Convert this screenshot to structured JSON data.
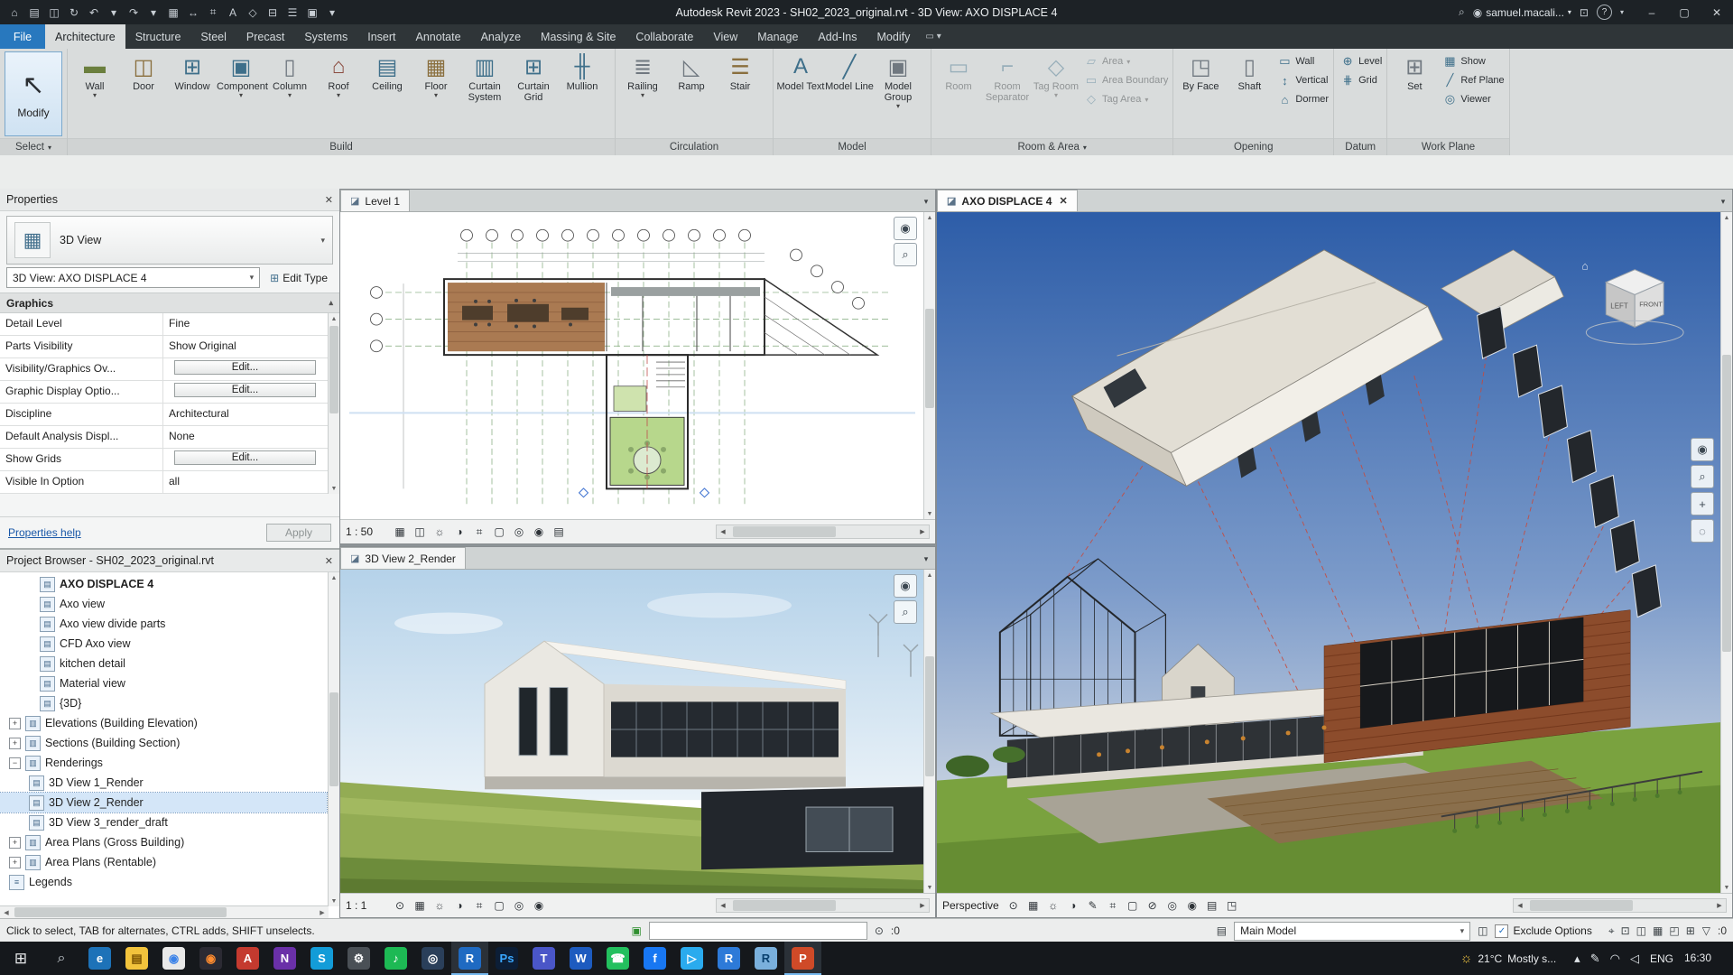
{
  "icons": {
    "caret_down": "▾",
    "caret_up": "▴",
    "close": "✕",
    "minimize": "–",
    "maximize": "▢",
    "left_arrow": "◀",
    "right_arrow": "▶",
    "up_arrow": "▲",
    "down_arrow": "▼",
    "check": "✓",
    "help": "?",
    "search": "⌕",
    "panel_toggle": "▭",
    "home": "⌂"
  },
  "title_bar": {
    "title": "Autodesk Revit 2023 - SH02_2023_original.rvt - 3D View: AXO DISPLACE 4",
    "user": "samuel.macali...",
    "qat_icons": [
      {
        "n": "home-icon",
        "g": "⌂"
      },
      {
        "n": "open-icon",
        "g": "▤"
      },
      {
        "n": "save-icon",
        "g": "◫"
      },
      {
        "n": "sync-icon",
        "g": "↻"
      },
      {
        "n": "undo-icon",
        "g": "↶"
      },
      {
        "n": "undo-dropdown-icon",
        "g": "▾"
      },
      {
        "n": "redo-icon",
        "g": "↷"
      },
      {
        "n": "redo-dropdown-icon",
        "g": "▾"
      },
      {
        "n": "print-icon",
        "g": "▦"
      },
      {
        "n": "measure-icon",
        "g": "↔"
      },
      {
        "n": "aligned-dimension-icon",
        "g": "⌗"
      },
      {
        "n": "text-icon",
        "g": "A"
      },
      {
        "n": "default-3d-view-icon",
        "g": "◇"
      },
      {
        "n": "section-icon",
        "g": "⊟"
      },
      {
        "n": "thin-lines-icon",
        "g": "☰"
      },
      {
        "n": "switch-windows-icon",
        "g": "▣"
      },
      {
        "n": "qat-customize-icon",
        "g": "▾"
      }
    ],
    "right_icons_a": [
      {
        "n": "search-icon",
        "g": "⌕"
      },
      {
        "n": "account-icon",
        "g": "◉"
      }
    ],
    "right_icons_b": [
      {
        "n": "app-store-icon",
        "g": "⊡"
      }
    ],
    "window_controls": [
      {
        "n": "minimize-button",
        "g": "–"
      },
      {
        "n": "maximize-button",
        "g": "▢"
      },
      {
        "n": "close-button",
        "g": "✕"
      }
    ]
  },
  "ribbon": {
    "file_tab": "File",
    "select_label": "Select",
    "modify_button": {
      "label": "Modify",
      "icon": "↖"
    },
    "tabs": [
      {
        "n": "tab-architecture",
        "label": "Architecture",
        "active": true
      },
      {
        "n": "tab-structure",
        "label": "Structure"
      },
      {
        "n": "tab-steel",
        "label": "Steel"
      },
      {
        "n": "tab-precast",
        "label": "Precast"
      },
      {
        "n": "tab-systems",
        "label": "Systems"
      },
      {
        "n": "tab-insert",
        "label": "Insert"
      },
      {
        "n": "tab-annotate",
        "label": "Annotate"
      },
      {
        "n": "tab-analyze",
        "label": "Analyze"
      },
      {
        "n": "tab-massing-site",
        "label": "Massing & Site"
      },
      {
        "n": "tab-collaborate",
        "label": "Collaborate"
      },
      {
        "n": "tab-view",
        "label": "View"
      },
      {
        "n": "tab-manage",
        "label": "Manage"
      },
      {
        "n": "tab-addins",
        "label": "Add-Ins"
      },
      {
        "n": "tab-modify",
        "label": "Modify"
      }
    ],
    "panels": [
      {
        "pn": "ribbon-panel-build",
        "label": "Build",
        "big": [
          {
            "n": "wall-button",
            "label": "Wall",
            "icon": "▬",
            "arrow": true,
            "c": "#6b7f3e"
          },
          {
            "n": "door-button",
            "label": "Door",
            "icon": "◫",
            "c": "#8a6f3e"
          },
          {
            "n": "window-button",
            "label": "Window",
            "icon": "⊞",
            "c": "#3e6f8a"
          },
          {
            "n": "component-button",
            "label": "Component",
            "icon": "▣",
            "arrow": true,
            "c": "#3e6f8a"
          },
          {
            "n": "column-button",
            "label": "Column",
            "icon": "▯",
            "arrow": true,
            "c": "#707880"
          },
          {
            "n": "roof-button",
            "label": "Roof",
            "icon": "⌂",
            "arrow": true,
            "c": "#8a4a3e"
          },
          {
            "n": "ceiling-button",
            "label": "Ceiling",
            "icon": "▤",
            "c": "#3e6f8a"
          },
          {
            "n": "floor-button",
            "label": "Floor",
            "icon": "▦",
            "arrow": true,
            "c": "#8a6f3e"
          },
          {
            "n": "curtain-system-button",
            "label": "Curtain System",
            "icon": "▥",
            "c": "#3e6f8a"
          },
          {
            "n": "curtain-grid-button",
            "label": "Curtain Grid",
            "icon": "⊞",
            "c": "#3e6f8a"
          },
          {
            "n": "mullion-button",
            "label": "Mullion",
            "icon": "╫",
            "c": "#3e6f8a"
          }
        ],
        "small": []
      },
      {
        "pn": "ribbon-panel-circulation",
        "label": "Circulation",
        "big": [
          {
            "n": "railing-button",
            "label": "Railing",
            "icon": "≣",
            "arrow": true,
            "c": "#707880"
          },
          {
            "n": "ramp-button",
            "label": "Ramp",
            "icon": "◺",
            "c": "#707880"
          },
          {
            "n": "stair-button",
            "label": "Stair",
            "icon": "☰",
            "c": "#8a6f3e"
          }
        ],
        "small": []
      },
      {
        "pn": "ribbon-panel-model",
        "label": "Model",
        "big": [
          {
            "n": "model-text-button",
            "label": "Model Text",
            "icon": "A",
            "c": "#3e6f8a"
          },
          {
            "n": "model-line-button",
            "label": "Model Line",
            "icon": "╱",
            "c": "#3e6f8a"
          },
          {
            "n": "model-group-button",
            "label": "Model Group",
            "icon": "▣",
            "arrow": true,
            "c": "#707880"
          }
        ],
        "small": []
      },
      {
        "pn": "ribbon-panel-room-area",
        "label": "Room & Area",
        "arrow": true,
        "big": [
          {
            "n": "room-button",
            "label": "Room",
            "icon": "▭",
            "dis": true,
            "c": "#3e6f8a"
          },
          {
            "n": "room-separator-button",
            "label": "Room Separator",
            "icon": "⌐",
            "dis": true,
            "c": "#3e6f8a"
          },
          {
            "n": "tag-room-button",
            "label": "Tag Room",
            "icon": "◇",
            "arrow": true,
            "dis": true,
            "c": "#3e6f8a"
          }
        ],
        "small": [
          {
            "n": "area-button",
            "label": "Area",
            "icon": "▱",
            "arrow": true,
            "dis": true
          },
          {
            "n": "area-boundary-button",
            "label": "Area Boundary",
            "icon": "▭",
            "dis": true
          },
          {
            "n": "tag-area-button",
            "label": "Tag Area",
            "icon": "◇",
            "arrow": true,
            "dis": true
          }
        ]
      },
      {
        "pn": "ribbon-panel-opening",
        "label": "Opening",
        "big": [
          {
            "n": "opening-by-face-button",
            "label": "By Face",
            "icon": "◳",
            "c": "#707880"
          },
          {
            "n": "shaft-button",
            "label": "Shaft",
            "icon": "▯",
            "c": "#707880"
          }
        ],
        "small": [
          {
            "n": "wall-opening-button",
            "label": "Wall",
            "icon": "▭"
          },
          {
            "n": "vertical-opening-button",
            "label": "Vertical",
            "icon": "↕"
          },
          {
            "n": "dormer-button",
            "label": "Dormer",
            "icon": "⌂"
          }
        ]
      },
      {
        "pn": "ribbon-panel-datum",
        "label": "Datum",
        "big": [],
        "small": [
          {
            "n": "level-button",
            "label": "Level",
            "icon": "⊕"
          },
          {
            "n": "grid-button",
            "label": "Grid",
            "icon": "⋕"
          }
        ]
      },
      {
        "pn": "ribbon-panel-work-plane",
        "label": "Work Plane",
        "big": [
          {
            "n": "set-work-plane-button",
            "label": "Set",
            "icon": "⊞",
            "c": "#707880"
          }
        ],
        "small": [
          {
            "n": "show-work-plane-button",
            "label": "Show",
            "icon": "▦"
          },
          {
            "n": "ref-plane-button",
            "label": "Ref Plane",
            "icon": "╱"
          },
          {
            "n": "viewer-button",
            "label": "Viewer",
            "icon": "◎"
          }
        ]
      }
    ]
  },
  "properties": {
    "title": "Properties",
    "type_icon": "▦",
    "type_label": "3D View",
    "selector_value": "3D View: AXO DISPLACE 4",
    "edit_type_icon": "⊞",
    "edit_type_label": "Edit Type",
    "section_graphics": "Graphics",
    "rows": [
      {
        "label": "Detail Level",
        "value": "Fine",
        "txt": true
      },
      {
        "label": "Parts Visibility",
        "value": "Show Original",
        "txt": true
      },
      {
        "label": "Visibility/Graphics Ov...",
        "value": "Edit...",
        "btn": true
      },
      {
        "label": "Graphic Display Optio...",
        "value": "Edit...",
        "btn": true
      },
      {
        "label": "Discipline",
        "value": "Architectural",
        "txt": true
      },
      {
        "label": "Default Analysis Displ...",
        "value": "None",
        "txt": true
      },
      {
        "label": "Show Grids",
        "value": "Edit...",
        "btn": true
      },
      {
        "label": "Visible In Option",
        "value": "all",
        "txt": true
      }
    ],
    "help_label": "Properties help",
    "apply_label": "Apply"
  },
  "browser": {
    "title": "Project Browser - SH02_2023_original.rvt",
    "items": [
      {
        "label": "AXO DISPLACE 4",
        "pad": "44px",
        "bold": true,
        "ticon": "▤"
      },
      {
        "label": "Axo view",
        "pad": "44px",
        "ticon": "▤"
      },
      {
        "label": "Axo view divide parts",
        "pad": "44px",
        "ticon": "▤"
      },
      {
        "label": "CFD Axo view",
        "pad": "44px",
        "ticon": "▤"
      },
      {
        "label": "kitchen detail",
        "pad": "44px",
        "ticon": "▤"
      },
      {
        "label": "Material view",
        "pad": "44px",
        "ticon": "▤"
      },
      {
        "label": "{3D}",
        "pad": "44px",
        "ticon": "▤"
      },
      {
        "label": "Elevations (Building Elevation)",
        "pad": "10px",
        "exp": "+",
        "ticon": "▥"
      },
      {
        "label": "Sections (Building Section)",
        "pad": "10px",
        "exp": "+",
        "ticon": "▥"
      },
      {
        "label": "Renderings",
        "pad": "10px",
        "exp": "−",
        "ticon": "▥"
      },
      {
        "label": "3D View 1_Render",
        "pad": "32px",
        "ticon": "▤"
      },
      {
        "label": "3D View 2_Render",
        "pad": "32px",
        "sel": true,
        "ticon": "▤"
      },
      {
        "label": "3D View 3_render_draft",
        "pad": "32px",
        "ticon": "▤"
      },
      {
        "label": "Area Plans (Gross Building)",
        "pad": "10px",
        "exp": "+",
        "ticon": "▥"
      },
      {
        "label": "Area Plans (Rentable)",
        "pad": "10px",
        "exp": "+",
        "ticon": "▥"
      },
      {
        "label": "Legends",
        "pad": "10px",
        "ticon": "≡"
      }
    ]
  },
  "views": {
    "mini_nav": [
      {
        "n": "steering-wheel-icon",
        "g": "◉"
      },
      {
        "n": "zoom-icon",
        "g": "⌕"
      }
    ],
    "plan": {
      "tab": "Level 1",
      "ticon": "◪",
      "scale": "1 : 50",
      "bar_icons": [
        {
          "n": "visual-style-icon",
          "g": "▦"
        },
        {
          "n": "detail-level-icon",
          "g": "◫"
        },
        {
          "n": "sun-path-icon",
          "g": "☼"
        },
        {
          "n": "shadows-icon",
          "g": "◑"
        },
        {
          "n": "crop-view-icon",
          "g": "⌗"
        },
        {
          "n": "crop-region-icon",
          "g": "▢"
        },
        {
          "n": "hide-isolate-icon",
          "g": "◎"
        },
        {
          "n": "reveal-hidden-icon",
          "g": "◉"
        },
        {
          "n": "temporary-view-properties-icon",
          "g": "▤"
        }
      ]
    },
    "render": {
      "tab": "3D View 2_Render",
      "ticon": "◪",
      "scale": "1 : 1",
      "bar_icons": [
        {
          "n": "show-rendering-dialog-icon",
          "g": "⊙"
        },
        {
          "n": "visual-style-icon",
          "g": "▦"
        },
        {
          "n": "sun-path-icon",
          "g": "☼"
        },
        {
          "n": "shadows-icon",
          "g": "◑"
        },
        {
          "n": "crop-view-icon",
          "g": "⌗"
        },
        {
          "n": "crop-region-icon",
          "g": "▢"
        },
        {
          "n": "hide-isolate-icon",
          "g": "◎"
        },
        {
          "n": "reveal-hidden-icon",
          "g": "◉"
        }
      ]
    },
    "axo": {
      "tab": "AXO DISPLACE 4",
      "ticon": "◪",
      "mode_label": "Perspective",
      "viewcube": {
        "left": "LEFT",
        "front": "FRONT"
      },
      "bar_icons": [
        {
          "n": "show-rendering-dialog-icon",
          "g": "⊙"
        },
        {
          "n": "visual-style-icon",
          "g": "▦"
        },
        {
          "n": "sun-path-icon",
          "g": "☼"
        },
        {
          "n": "shadows-icon",
          "g": "◑"
        },
        {
          "n": "sketchy-lines-icon",
          "g": "✎"
        },
        {
          "n": "crop-view-icon",
          "g": "⌗"
        },
        {
          "n": "crop-region-icon",
          "g": "▢"
        },
        {
          "n": "lock-orientation-icon",
          "g": "⊘"
        },
        {
          "n": "hide-isolate-icon",
          "g": "◎"
        },
        {
          "n": "reveal-hidden-icon",
          "g": "◉"
        },
        {
          "n": "temporary-view-properties-icon",
          "g": "▤"
        },
        {
          "n": "displace-elements-icon",
          "g": "◳"
        }
      ],
      "nav_icons": [
        {
          "n": "steering-wheel-icon",
          "g": "◉"
        },
        {
          "n": "zoom-icon",
          "g": "⌕"
        },
        {
          "n": "pan-icon",
          "g": "+"
        },
        {
          "n": "orbit-icon",
          "g": "◌"
        }
      ]
    }
  },
  "status": {
    "hint": "Click to select, TAB for alternates, CTRL adds, SHIFT unselects.",
    "ready_icon": "▣",
    "pin_icon": "⊙",
    "counter1": ":0",
    "counter2": ":0",
    "workset_icon": "▤",
    "workset_label": "Main Model",
    "options_icon": "◫",
    "exclude_label": "Exclude Options",
    "filter_icon": "▽",
    "right_icons": [
      {
        "n": "editable-only-icon",
        "g": "⌖"
      },
      {
        "n": "worksharing-display-icon",
        "g": "⊡"
      },
      {
        "n": "link-icon",
        "g": "◫"
      },
      {
        "n": "background-processes-icon",
        "g": "▦"
      },
      {
        "n": "select-underlay-icon",
        "g": "◰"
      },
      {
        "n": "drag-on-selection-icon",
        "g": "⊞"
      }
    ]
  },
  "taskbar": {
    "start_icon": "⊞",
    "search_icon": "⌕",
    "apps": [
      {
        "n": "taskbar-edge",
        "g": "e",
        "bg": "#1d72b8"
      },
      {
        "n": "taskbar-explorer",
        "g": "▤",
        "bg": "#f2c33c",
        "fg": "#7a5200"
      },
      {
        "n": "taskbar-chrome",
        "g": "◉",
        "bg": "#e8e8e8",
        "fg": "#3b82e8"
      },
      {
        "n": "taskbar-firefox",
        "g": "◉",
        "bg": "#2b2a33",
        "fg": "#ff8b2e"
      },
      {
        "n": "taskbar-autodesk",
        "g": "A",
        "bg": "#c43a2f"
      },
      {
        "n": "taskbar-onenote",
        "g": "N",
        "bg": "#6a30a8"
      },
      {
        "n": "taskbar-skype",
        "g": "S",
        "bg": "#139cd8"
      },
      {
        "n": "taskbar-settings",
        "g": "⚙",
        "bg": "#4a5056"
      },
      {
        "n": "taskbar-spotify",
        "g": "♪",
        "bg": "#1db954"
      },
      {
        "n": "taskbar-steam",
        "g": "◎",
        "bg": "#2a3f5a"
      },
      {
        "n": "taskbar-revit",
        "g": "R",
        "bg": "#1f6ac2",
        "active": true
      },
      {
        "n": "taskbar-photoshop",
        "g": "Ps",
        "bg": "#0c1e36",
        "fg": "#3aa8ff"
      },
      {
        "n": "taskbar-teams",
        "g": "T",
        "bg": "#4a56c8"
      },
      {
        "n": "taskbar-word",
        "g": "W",
        "bg": "#1d5bbf"
      },
      {
        "n": "taskbar-whatsapp",
        "g": "☎",
        "bg": "#23c05e"
      },
      {
        "n": "taskbar-facebook",
        "g": "f",
        "bg": "#1877f2"
      },
      {
        "n": "taskbar-telegram",
        "g": "▷",
        "bg": "#2aabee"
      },
      {
        "n": "taskbar-revit-2",
        "g": "R",
        "bg": "#2d7ad8"
      },
      {
        "n": "taskbar-rstudio",
        "g": "R",
        "bg": "#7ab0dc",
        "fg": "#08406e"
      },
      {
        "n": "taskbar-powerpoint",
        "g": "P",
        "bg": "#cf4a28",
        "active": true
      }
    ],
    "weather": {
      "icon": "☼",
      "temp": "21°C",
      "desc": "Mostly s..."
    },
    "tray_icons": [
      {
        "n": "tray-expand-icon",
        "g": "▴"
      },
      {
        "n": "pen-icon",
        "g": "✎"
      },
      {
        "n": "wifi-icon",
        "g": "◠"
      },
      {
        "n": "volume-icon",
        "g": "◁"
      }
    ],
    "lang": "ENG",
    "time": "16:30"
  }
}
